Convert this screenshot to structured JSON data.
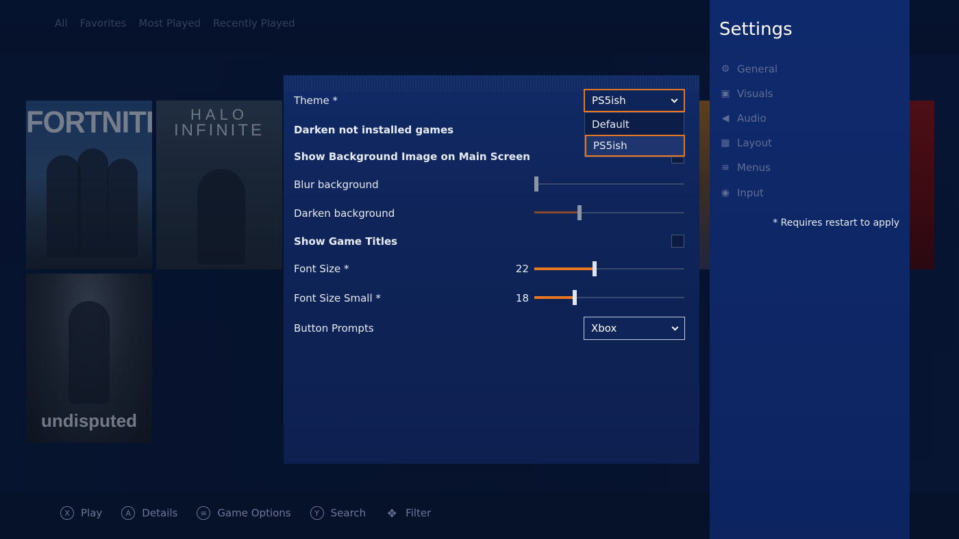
{
  "library": {
    "tabs": [
      "All",
      "Favorites",
      "Most Played",
      "Recently Played"
    ],
    "tiles": {
      "fortnite": "FORTNITE",
      "halo_line1": "HALO",
      "halo_line2": "INFINITE",
      "undisputed": "undisputed"
    }
  },
  "prompts": [
    {
      "button": "X",
      "label": "Play"
    },
    {
      "button": "A",
      "label": "Details"
    },
    {
      "button": "≡",
      "label": "Game Options"
    },
    {
      "button": "Y",
      "label": "Search"
    },
    {
      "button": "✥",
      "label": "Filter"
    }
  ],
  "panel": {
    "theme": {
      "label": "Theme *",
      "value": "PS5ish",
      "options": [
        "Default",
        "PS5ish"
      ]
    },
    "darken_not_installed": {
      "label": "Darken not installed games"
    },
    "show_bg_image": {
      "label": "Show Background Image on Main Screen"
    },
    "blur_bg": {
      "label": "Blur background",
      "value_fraction": 0.0
    },
    "darken_bg": {
      "label": "Darken background",
      "value_fraction": 0.3
    },
    "show_titles": {
      "label": "Show Game Titles",
      "checked": false
    },
    "font_size": {
      "label": "Font Size *",
      "value": "22",
      "value_fraction": 0.4
    },
    "font_size_small": {
      "label": "Font Size Small *",
      "value": "18",
      "value_fraction": 0.27
    },
    "button_prompts": {
      "label": "Button Prompts",
      "value": "Xbox"
    }
  },
  "sidebar": {
    "title": "Settings",
    "items": [
      {
        "label": "General",
        "icon": "gear-icon",
        "glyph": "⚙"
      },
      {
        "label": "Visuals",
        "icon": "image-icon",
        "glyph": "▣"
      },
      {
        "label": "Audio",
        "icon": "speaker-icon",
        "glyph": "◀"
      },
      {
        "label": "Layout",
        "icon": "grid-icon",
        "glyph": "▦"
      },
      {
        "label": "Menus",
        "icon": "menu-icon",
        "glyph": "≡"
      },
      {
        "label": "Input",
        "icon": "gamepad-icon",
        "glyph": "◉"
      }
    ],
    "note": "* Requires restart to apply"
  },
  "colors": {
    "accent": "#e8781e",
    "panel_bg": "#0f2459",
    "sidebar_bg": "#0e2766"
  }
}
